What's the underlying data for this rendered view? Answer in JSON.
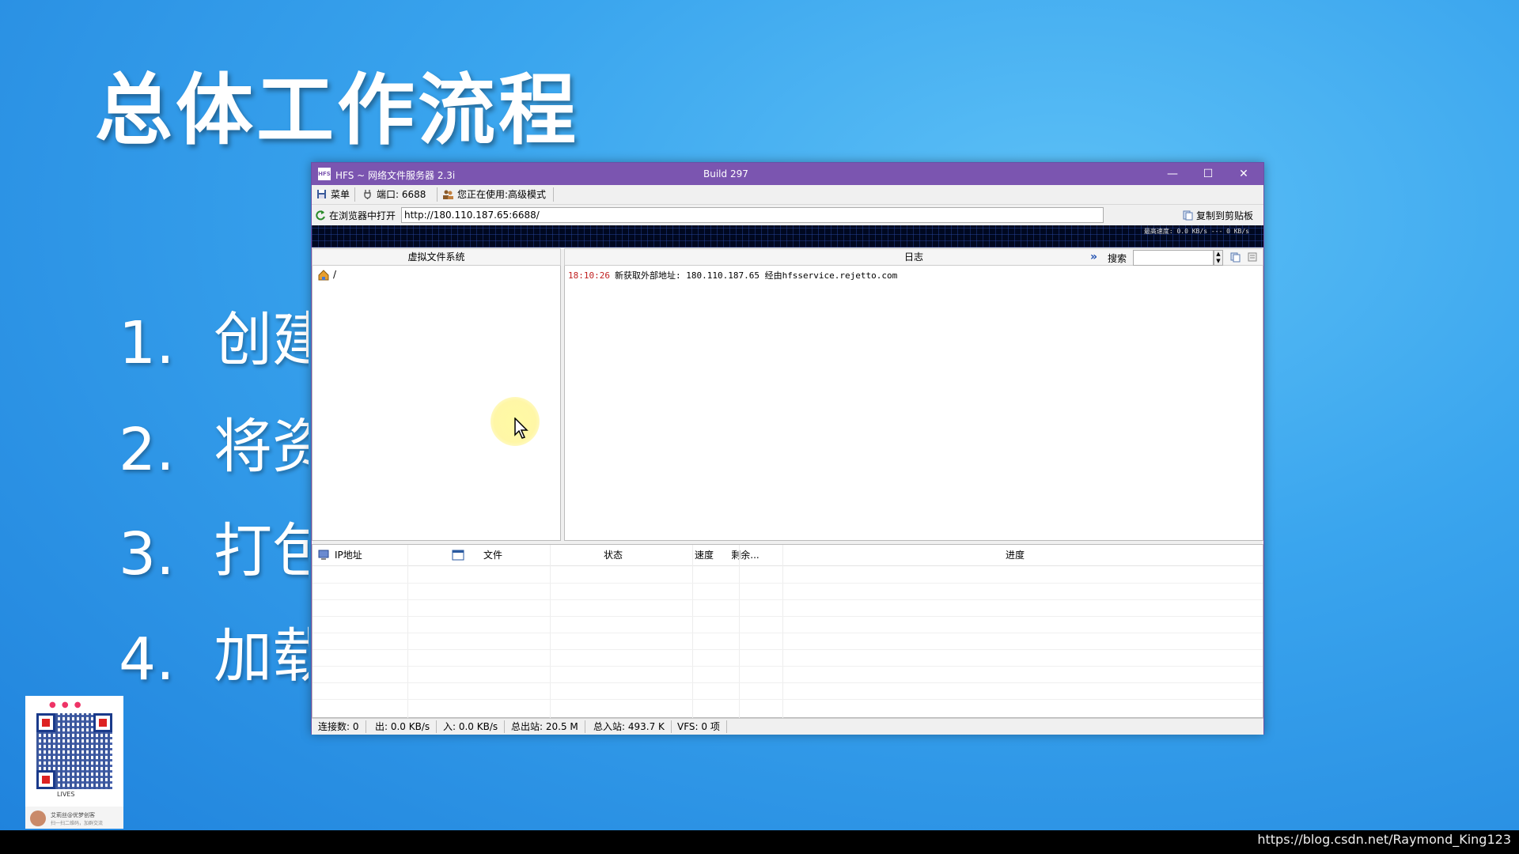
{
  "slide": {
    "title": "总体工作流程",
    "steps": [
      {
        "num": "1.",
        "text": "创建"
      },
      {
        "num": "2.",
        "text": "将资"
      },
      {
        "num": "3.",
        "text": "打包"
      },
      {
        "num": "4.",
        "text": "加载"
      }
    ]
  },
  "window": {
    "title": "HFS ~ 网络文件服务器 2.3i",
    "build": "Build 297",
    "controls": {
      "minimize": "—",
      "maximize": "☐",
      "close": "✕"
    }
  },
  "toolbar": {
    "menu_label": "菜单",
    "port_label": "端口: 6688",
    "mode_label": "您正在使用:高级模式"
  },
  "urlbar": {
    "open_label": "在浏览器中打开",
    "url": "http://180.110.187.65:6688/",
    "copy_label": "复制到剪贴板"
  },
  "graph": {
    "speed_text": "最高速度: 0.0 KB/s --- 0 KB/s"
  },
  "vfs": {
    "header": "虚拟文件系统",
    "root": "/"
  },
  "log": {
    "header": "日志",
    "search_label": "搜索",
    "entries": [
      {
        "time": "18:10:26",
        "message": "新获取外部地址: 180.110.187.65 经由hfsservice.rejetto.com"
      }
    ]
  },
  "connections": {
    "columns": [
      "IP地址",
      "文件",
      "状态",
      "速度",
      "剩余...",
      "进度"
    ]
  },
  "statusbar": {
    "connections": "连接数: 0",
    "out": "出: 0.0 KB/s",
    "in": "入: 0.0 KB/s",
    "total_out": "总出站: 20.5 M",
    "total_in": "总入站: 493.7 K",
    "vfs": "VFS: 0 项"
  },
  "qr": {
    "lives": "LIVES",
    "name": "艾莉丝@优梦创客",
    "sub": "扫一扫二维码，加群交流"
  },
  "watermark": "https://blog.csdn.net/Raymond_King123",
  "colors": {
    "titlebar": "#7b55b0",
    "background": "#3aa5ee",
    "log_time": "#c02020"
  }
}
